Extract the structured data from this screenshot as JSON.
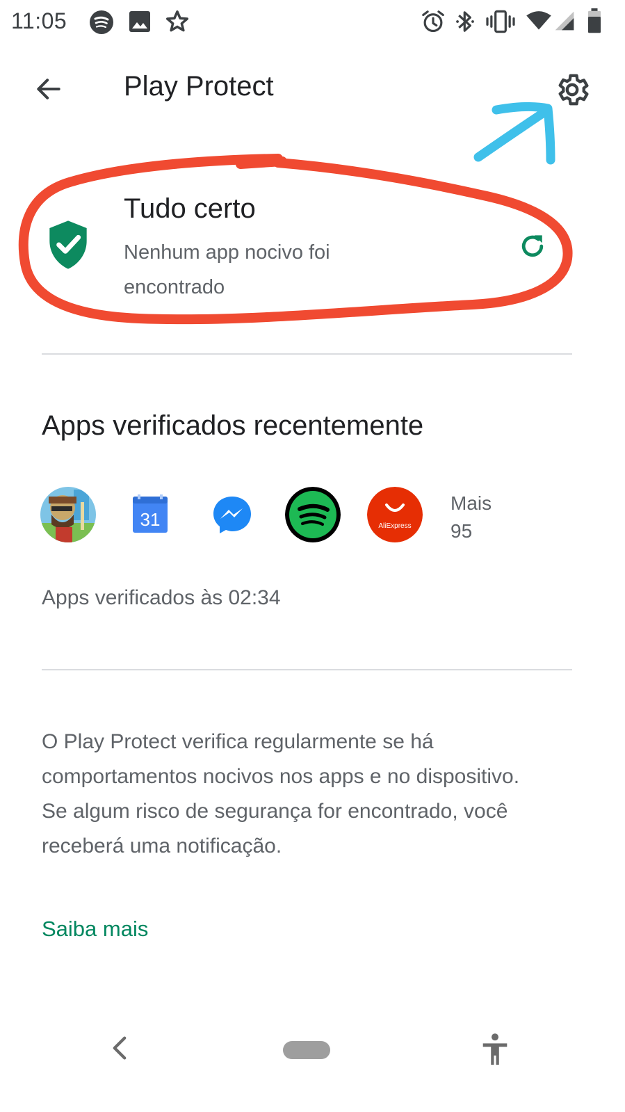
{
  "status_bar": {
    "time": "11:05",
    "left_icons": [
      "spotify-icon",
      "image-icon",
      "star-icon"
    ],
    "right_icons": [
      "alarm-icon",
      "bluetooth-icon",
      "vibrate-icon",
      "wifi-icon",
      "signal-icon",
      "battery-icon"
    ]
  },
  "app_bar": {
    "title": "Play Protect",
    "back_icon": "arrow-back-icon",
    "settings_icon": "gear-icon"
  },
  "status_card": {
    "title": "Tudo certo",
    "description": "Nenhum app nocivo foi encontrado",
    "icon": "shield-check-icon",
    "action_icon": "refresh-icon",
    "accent_color": "#0d8a5f"
  },
  "recent_apps": {
    "title": "Apps verificados recentemente",
    "apps": [
      {
        "name": "game-app",
        "label": ""
      },
      {
        "name": "calendar-app",
        "label": "31"
      },
      {
        "name": "messenger-app",
        "label": ""
      },
      {
        "name": "spotify-app",
        "label": ""
      },
      {
        "name": "aliexpress-app",
        "label": "AliExpress"
      }
    ],
    "more_label": "Mais",
    "more_count": "95"
  },
  "checked_time": "Apps verificados às 02:34",
  "info_text": "O Play Protect verifica regularmente se há comportamentos nocivos nos apps e no dispositivo. Se algum risco de segurança for encontrado, você receberá uma notificação.",
  "learn_more": "Saiba mais",
  "annotations": {
    "red_circle_color": "#f04a31",
    "blue_arrow_color": "#3fc0ea"
  },
  "nav_bar": {
    "icons": [
      "nav-back-icon",
      "home-pill-icon",
      "accessibility-icon"
    ]
  }
}
